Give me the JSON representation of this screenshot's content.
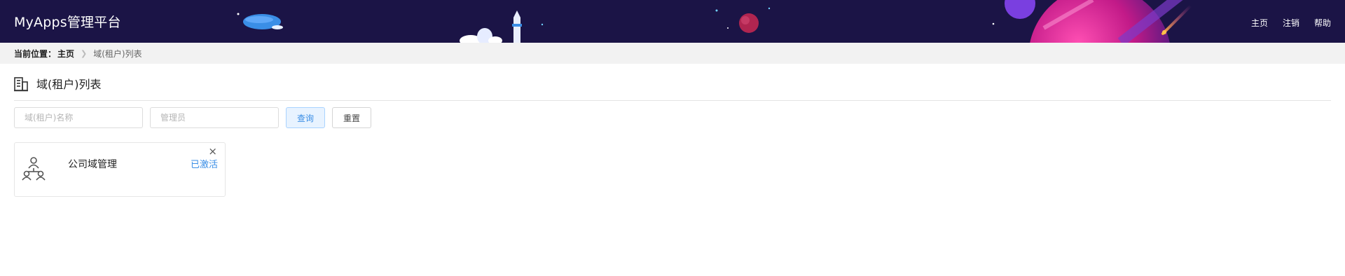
{
  "app": {
    "title": "MyApps管理平台"
  },
  "header": {
    "nav": [
      {
        "label": "主页"
      },
      {
        "label": "注销"
      },
      {
        "label": "帮助"
      }
    ]
  },
  "breadcrumb": {
    "label": "当前位置：",
    "home": "主页",
    "current": "域(租户)列表"
  },
  "page": {
    "title": "域(租户)列表",
    "icon": "building-icon"
  },
  "filters": {
    "name_placeholder": "域(租户)名称",
    "name_value": "",
    "admin_placeholder": "管理员",
    "admin_value": "",
    "query_label": "查询",
    "reset_label": "重置"
  },
  "cards": [
    {
      "name": "公司域管理",
      "status": "已激活",
      "icon": "org-users-icon",
      "close": "×"
    }
  ],
  "colors": {
    "header_bg": "#1b1446",
    "accent": "#3a8ee6",
    "breadcrumb_bg": "#f2f2f2"
  }
}
